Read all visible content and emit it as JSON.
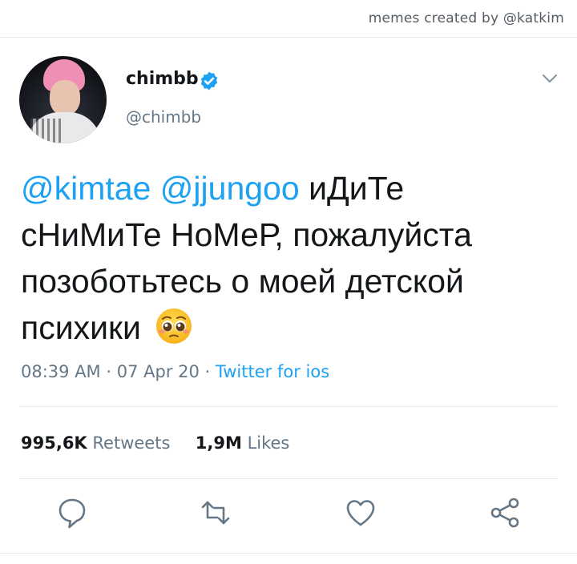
{
  "watermark": "memes created by @katkim",
  "tweet": {
    "display_name": "chimbb",
    "handle": "@chimbb",
    "verified": true,
    "mention_1": "@kimtae",
    "mention_2": "@jjungoo",
    "text_part_1": "иДиТе",
    "text_part_2": "сНиМиТе НоМеР, пожалуйста позоботьтесь о моей детской психики",
    "emoji": "pleading-face",
    "time": "08:39 AM",
    "date": "07 Apr 20",
    "source": "Twitter for ios",
    "retweets_count": "995,6K",
    "retweets_label": "Retweets",
    "likes_count": "1,9M",
    "likes_label": "Likes"
  },
  "colors": {
    "accent": "#1da1f2",
    "muted": "#657786",
    "text": "#14171a",
    "divider": "#e1e8ed"
  },
  "icons": {
    "chevron": "chevron-down-icon",
    "reply": "reply-icon",
    "retweet": "retweet-icon",
    "like": "heart-icon",
    "share": "share-icon",
    "verified": "verified-badge-icon"
  }
}
